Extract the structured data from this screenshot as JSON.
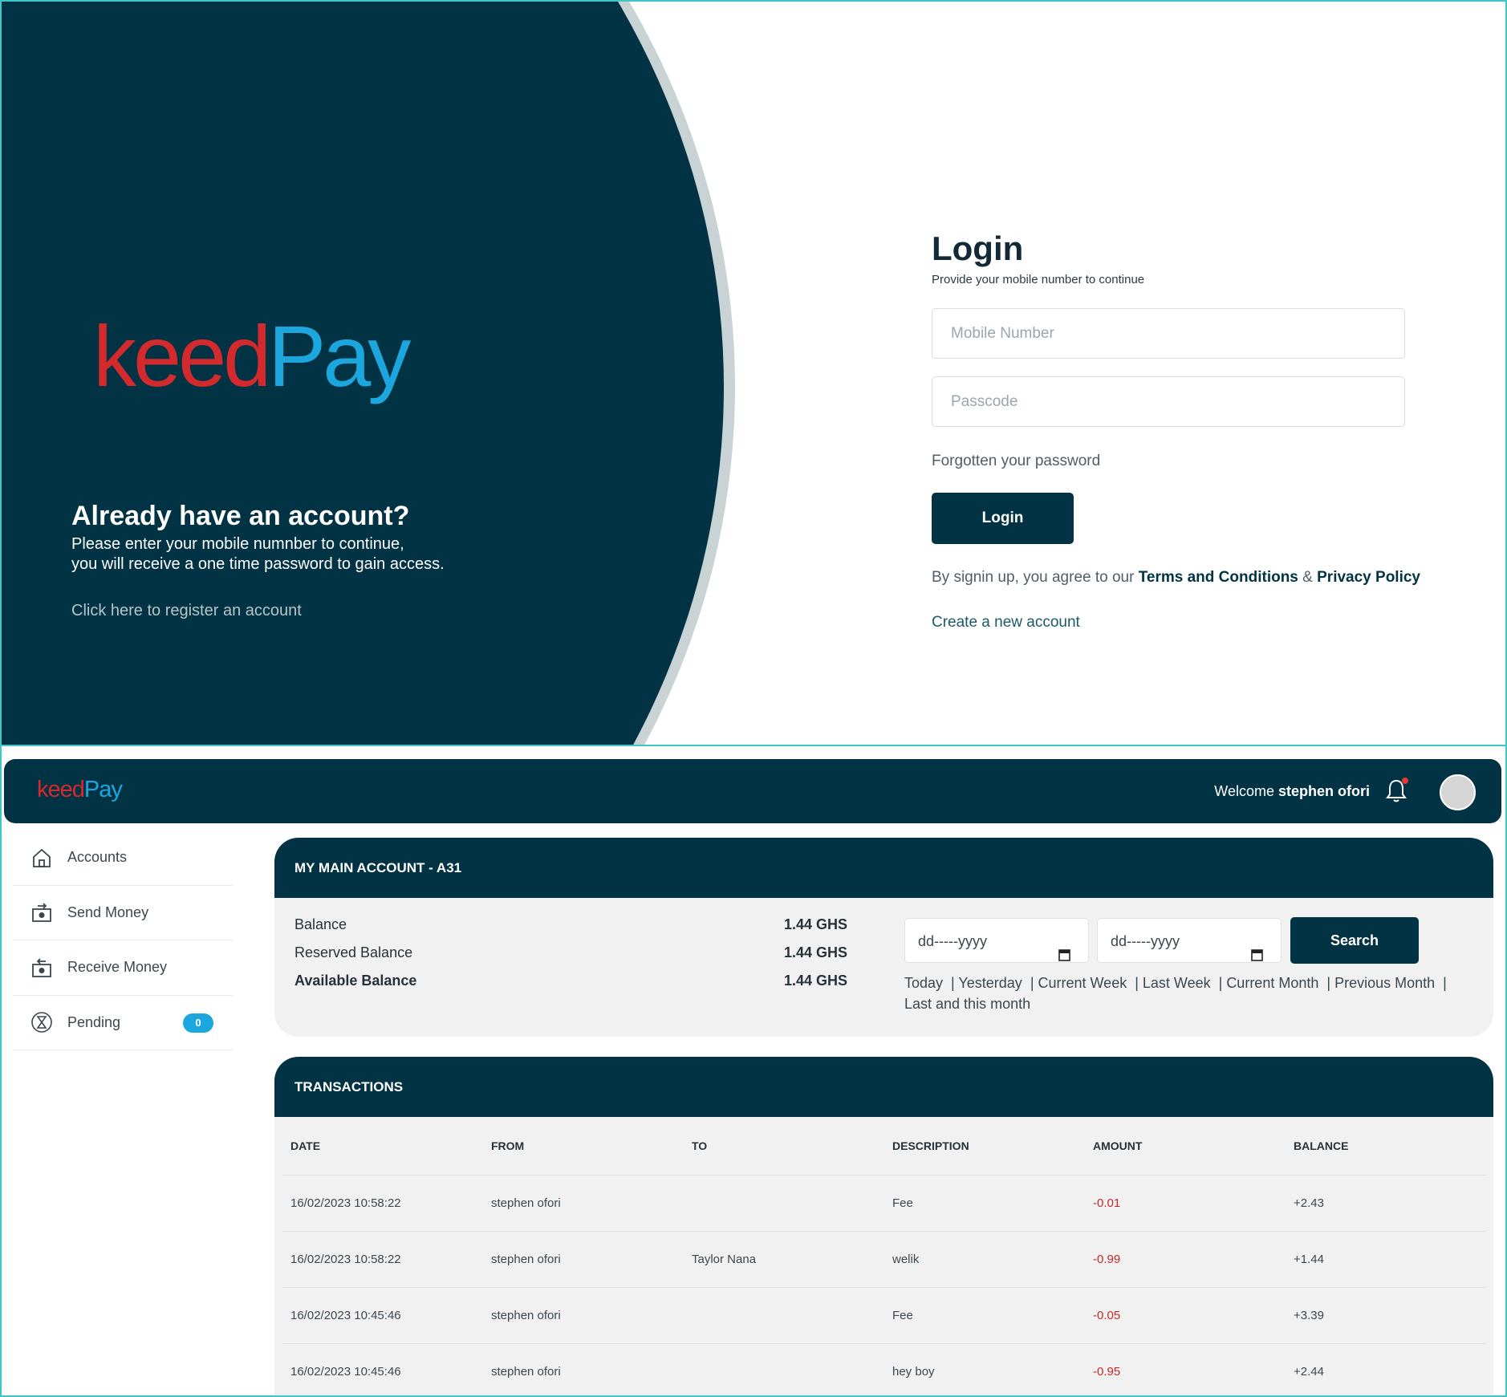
{
  "login": {
    "logo_keed": "keed",
    "logo_pay": "Pay",
    "already_title": "Already have an account?",
    "please_line1": "Please enter your mobile numnber to continue,",
    "please_line2": "you will receive a one time password to gain access.",
    "register_link": "Click here to register an account",
    "title": "Login",
    "subtitle": "Provide your mobile number to continue",
    "mobile_placeholder": "Mobile Number",
    "passcode_placeholder": "Passcode",
    "forgot": "Forgotten your password",
    "login_button": "Login",
    "agree_prefix": "By signin up, you agree to our ",
    "terms": "Terms and Conditions",
    "amp": " & ",
    "privacy": "Privacy Policy",
    "create": "Create a new account"
  },
  "dashboard": {
    "logo_keed": "keed",
    "logo_pay": "Pay",
    "welcome_prefix": "Welcome ",
    "user_name": "stephen ofori",
    "sidebar": {
      "items": [
        {
          "label": "Accounts",
          "icon": "home-icon"
        },
        {
          "label": "Send Money",
          "icon": "send-money-icon"
        },
        {
          "label": "Receive Money",
          "icon": "receive-money-icon"
        },
        {
          "label": "Pending",
          "icon": "hourglass-icon",
          "badge": "0"
        }
      ]
    },
    "account": {
      "title": "MY MAIN ACCOUNT - A31",
      "balance_label": "Balance",
      "balance_value": "1.44 GHS",
      "reserved_label": "Reserved Balance",
      "reserved_value": "1.44 GHS",
      "available_label": "Available Balance",
      "available_value": "1.44 GHS",
      "date_from": "dd-----yyyy",
      "date_to": "dd-----yyyy",
      "search_button": "Search",
      "quick_filters": [
        "Today",
        "Yesterday",
        "Current Week",
        "Last Week",
        "Current Month",
        "Previous Month",
        "Last and this month"
      ]
    },
    "transactions": {
      "title": "TRANSACTIONS",
      "columns": [
        "DATE",
        "FROM",
        "TO",
        "DESCRIPTION",
        "AMOUNT",
        "BALANCE"
      ],
      "rows": [
        [
          "16/02/2023 10:58:22",
          "stephen ofori",
          "",
          "Fee",
          "-0.01",
          "+2.43"
        ],
        [
          "16/02/2023 10:58:22",
          "stephen ofori",
          "Taylor Nana",
          "welik",
          "-0.99",
          "+1.44"
        ],
        [
          "16/02/2023 10:45:46",
          "stephen ofori",
          "",
          "Fee",
          "-0.05",
          "+3.39"
        ],
        [
          "16/02/2023 10:45:46",
          "stephen ofori",
          "",
          "hey boy",
          "-0.95",
          "+2.44"
        ]
      ]
    }
  },
  "colors": {
    "brand_dark": "#023344",
    "brand_red": "#d22a2d",
    "brand_blue": "#1ba7dd",
    "negative": "#c62828"
  }
}
